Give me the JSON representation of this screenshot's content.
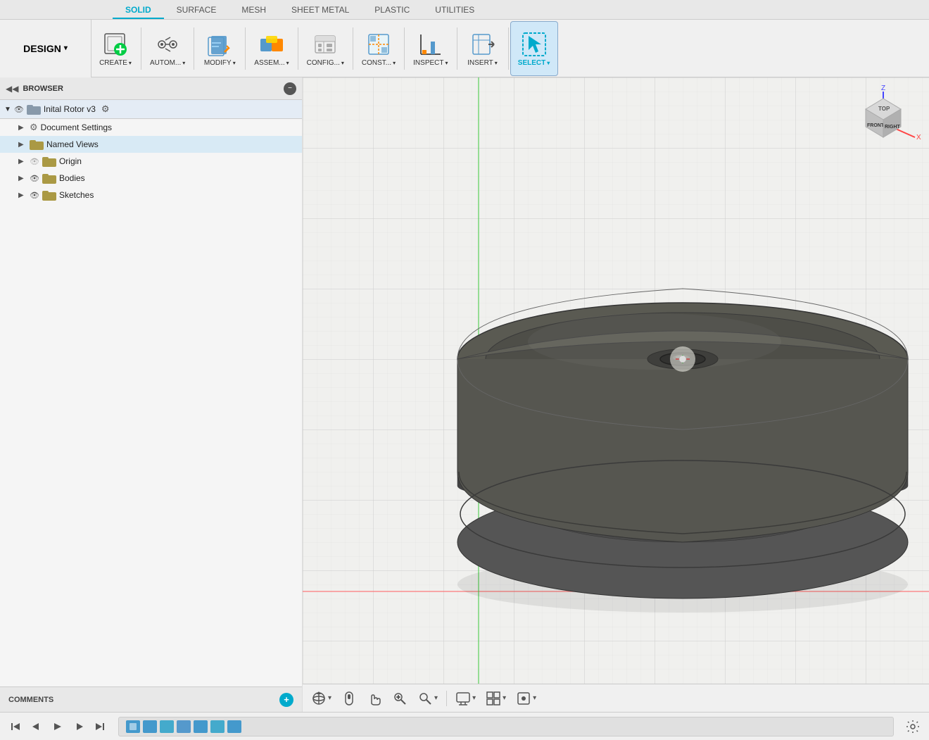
{
  "tabs": [
    {
      "label": "SOLID",
      "active": true
    },
    {
      "label": "SURFACE",
      "active": false
    },
    {
      "label": "MESH",
      "active": false
    },
    {
      "label": "SHEET METAL",
      "active": false
    },
    {
      "label": "PLASTIC",
      "active": false
    },
    {
      "label": "UTILITIES",
      "active": false
    }
  ],
  "toolbar": {
    "design_label": "DESIGN",
    "design_arrow": "▾",
    "groups": [
      {
        "label": "CREATE",
        "has_arrow": true
      },
      {
        "label": "AUTOM...",
        "has_arrow": true
      },
      {
        "label": "MODIFY",
        "has_arrow": true
      },
      {
        "label": "ASSEM...",
        "has_arrow": true
      },
      {
        "label": "CONFIG...",
        "has_arrow": true
      },
      {
        "label": "CONST...",
        "has_arrow": true
      },
      {
        "label": "INSPECT",
        "has_arrow": true
      },
      {
        "label": "INSERT",
        "has_arrow": true
      },
      {
        "label": "SELECT",
        "has_arrow": true
      }
    ]
  },
  "browser": {
    "title": "BROWSER",
    "document_name": "Inital Rotor v3",
    "items": [
      {
        "label": "Document Settings",
        "indent": 1,
        "has_gear": true,
        "has_eye": false,
        "has_folder": false
      },
      {
        "label": "Named Views",
        "indent": 1,
        "has_gear": false,
        "has_eye": false,
        "has_folder": true
      },
      {
        "label": "Origin",
        "indent": 1,
        "has_gear": false,
        "has_eye": true,
        "has_folder": true,
        "eye_hidden": true
      },
      {
        "label": "Bodies",
        "indent": 1,
        "has_gear": false,
        "has_eye": true,
        "has_folder": true
      },
      {
        "label": "Sketches",
        "indent": 1,
        "has_gear": false,
        "has_eye": true,
        "has_folder": true
      }
    ]
  },
  "comments": {
    "label": "COMMENTS",
    "add_icon": "+"
  },
  "bottom_toolbar": {
    "icons": [
      "⟳",
      "□",
      "✋",
      "🔍",
      "🔍",
      "🖥",
      "▦",
      "▦"
    ]
  },
  "playback": {
    "icons": [
      "|◀",
      "◀",
      "▶",
      "▶|",
      "▶▶|"
    ]
  },
  "viewport": {
    "bg_color": "#f0f0ee"
  },
  "navcube": {
    "top_label": "TOP",
    "front_label": "FRONT",
    "right_label": "RIGHT",
    "z_label": "Z",
    "x_label": "X"
  }
}
